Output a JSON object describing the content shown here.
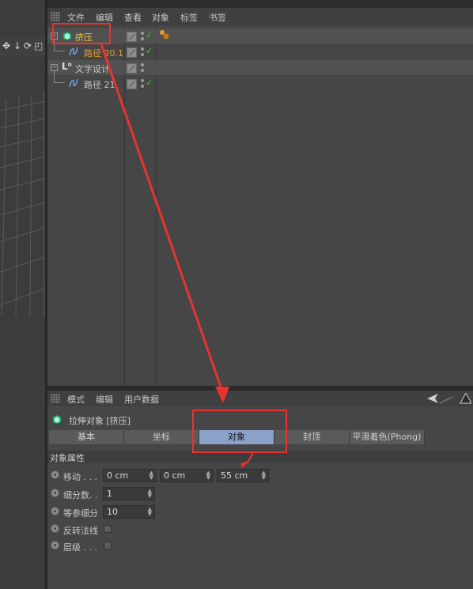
{
  "object_manager": {
    "menu": [
      "文件",
      "编辑",
      "查看",
      "对象",
      "标签",
      "书签"
    ],
    "objects": [
      {
        "name": "挤压",
        "type": "extrude",
        "color": "#e8c84a",
        "selected": true,
        "checked": true
      },
      {
        "name": "路径 20.1",
        "type": "spline",
        "color": "#e89a2a",
        "selected": false,
        "checked": true
      },
      {
        "name": "文字设计",
        "type": "null",
        "color": "#c8c8c8",
        "selected": false,
        "checked": false
      },
      {
        "name": "路径 21",
        "type": "spline",
        "color": "#c8c8c8",
        "selected": false,
        "checked": true
      }
    ]
  },
  "attribute_manager": {
    "menu": [
      "模式",
      "编辑",
      "用户数据"
    ],
    "object_title": "拉伸对象 [挤压]",
    "tabs": [
      {
        "label": "基本",
        "active": false
      },
      {
        "label": "坐标",
        "active": false
      },
      {
        "label": "对象",
        "active": true
      },
      {
        "label": "封顶",
        "active": false
      },
      {
        "label": "平滑着色(Phong)",
        "active": false
      }
    ],
    "section_title": "对象属性",
    "properties": {
      "move": {
        "label": "移动 . . .",
        "values": [
          "0 cm",
          "0 cm",
          "55 cm"
        ]
      },
      "subdivision": {
        "label": "细分数. .",
        "value": "1"
      },
      "iso_subdivision": {
        "label": "等参细分",
        "value": "10"
      },
      "flip_normals": {
        "label": "反转法线",
        "checked": false
      },
      "hierarchical": {
        "label": "层级 . . .",
        "checked": false
      }
    }
  },
  "colors": {
    "highlight_red": "#e8332f",
    "active_tab": "#8aa2c8",
    "check_green": "#38c838"
  }
}
